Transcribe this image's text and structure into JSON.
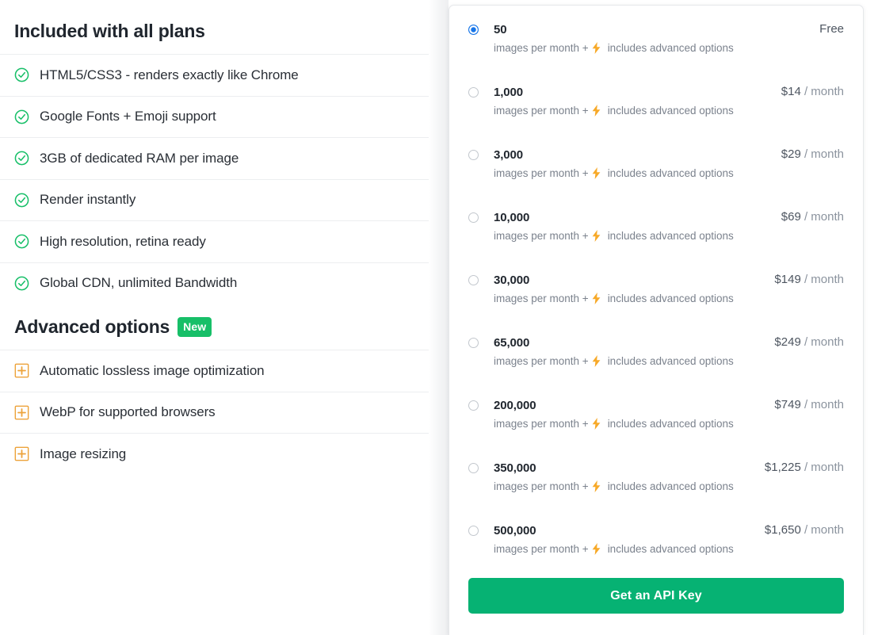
{
  "left_panel": {
    "included_heading": "Included with all plans",
    "included_features": [
      {
        "icon": "check-circle-icon",
        "label": "HTML5/CSS3 - renders exactly like Chrome"
      },
      {
        "icon": "check-circle-icon",
        "label": "Google Fonts + Emoji support"
      },
      {
        "icon": "check-circle-icon",
        "label": "3GB of dedicated RAM per image"
      },
      {
        "icon": "check-circle-icon",
        "label": "Render instantly"
      },
      {
        "icon": "check-circle-icon",
        "label": "High resolution, retina ready"
      },
      {
        "icon": "check-circle-icon",
        "label": "Global CDN, unlimited Bandwidth"
      }
    ],
    "advanced_heading": "Advanced options",
    "advanced_badge": "New",
    "advanced_features": [
      {
        "icon": "plus-box-icon",
        "label": "Automatic lossless image optimization"
      },
      {
        "icon": "plus-box-icon",
        "label": "WebP for supported browsers"
      },
      {
        "icon": "plus-box-icon",
        "label": "Image resizing"
      }
    ]
  },
  "pricing": {
    "sub_prefix": "images per month +",
    "sub_icon": "lightning-bolt-icon",
    "sub_suffix": "includes advanced options",
    "selected_index": 0,
    "plans": [
      {
        "quantity": "50",
        "amount": "Free",
        "per": "",
        "selected": true
      },
      {
        "quantity": "1,000",
        "amount": "$14",
        "per": " / month",
        "selected": false
      },
      {
        "quantity": "3,000",
        "amount": "$29",
        "per": " / month",
        "selected": false
      },
      {
        "quantity": "10,000",
        "amount": "$69",
        "per": " / month",
        "selected": false
      },
      {
        "quantity": "30,000",
        "amount": "$149",
        "per": " / month",
        "selected": false
      },
      {
        "quantity": "65,000",
        "amount": "$249",
        "per": " / month",
        "selected": false
      },
      {
        "quantity": "200,000",
        "amount": "$749",
        "per": " / month",
        "selected": false
      },
      {
        "quantity": "350,000",
        "amount": "$1,225",
        "per": " / month",
        "selected": false
      },
      {
        "quantity": "500,000",
        "amount": "$1,650",
        "per": " / month",
        "selected": false
      }
    ],
    "cta_label": "Get an API Key"
  },
  "colors": {
    "check_green": "#17bf68",
    "badge_green": "#17bf68",
    "cta_green": "#06b273",
    "bolt_orange": "#f7a928",
    "plus_orange": "#eda33b",
    "radio_blue": "#1775e8"
  }
}
